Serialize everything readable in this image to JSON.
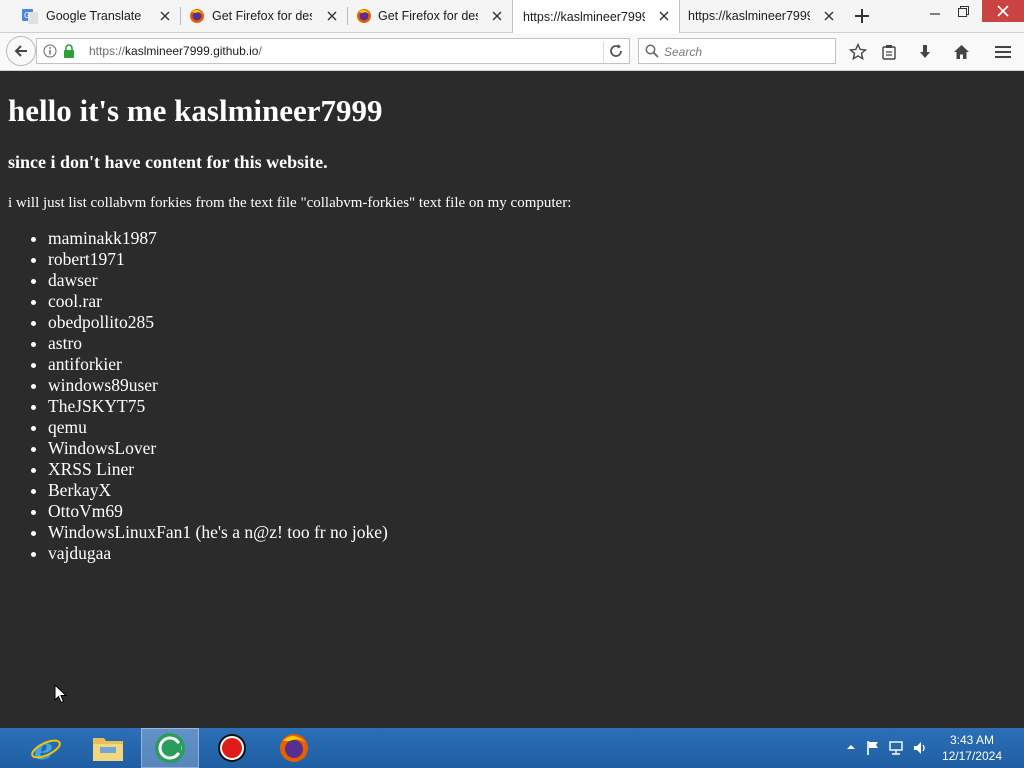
{
  "browser": {
    "tabs": [
      {
        "label": "Google Translate",
        "icon": "google-translate-icon",
        "active": false
      },
      {
        "label": "Get Firefox for des",
        "icon": "firefox-icon",
        "active": false
      },
      {
        "label": "Get Firefox for des",
        "icon": "firefox-icon",
        "active": false
      },
      {
        "label": "https://kaslmineer7999",
        "icon": "",
        "active": true
      },
      {
        "label": "https://kaslmineer7999",
        "icon": "",
        "active": false
      }
    ],
    "url": {
      "scheme": "https://",
      "host": "kaslmineer7999.github.io",
      "path": "/"
    },
    "search_placeholder": "Search"
  },
  "page": {
    "title": "hello it's me kaslmineer7999",
    "subtitle": "since i don't have content for this website.",
    "intro": "i will just list collabvm forkies from the text file \"collabvm-forkies\" text file on my computer:",
    "forkies": [
      "maminakk1987",
      "robert1971",
      "dawser",
      "cool.rar",
      "obedpollito285",
      "astro",
      "antiforkier",
      "windows89user",
      "TheJSKYT75",
      "qemu",
      "WindowsLover",
      "XRSS Liner",
      "BerkayX",
      "OttoVm69",
      "WindowsLinuxFan1 (he's a n@z! too fr no joke)",
      "vajdugaa"
    ]
  },
  "taskbar": {
    "apps": [
      "internet-explorer-icon",
      "file-explorer-icon",
      "collabvm-icon",
      "recorder-icon",
      "firefox-icon"
    ],
    "time": "3:43 AM",
    "date": "12/17/2024"
  },
  "colors": {
    "page_background": "#2b2b2b",
    "page_text": "#ffffff",
    "taskbar": "#2467ad",
    "close_button": "#c94343"
  }
}
